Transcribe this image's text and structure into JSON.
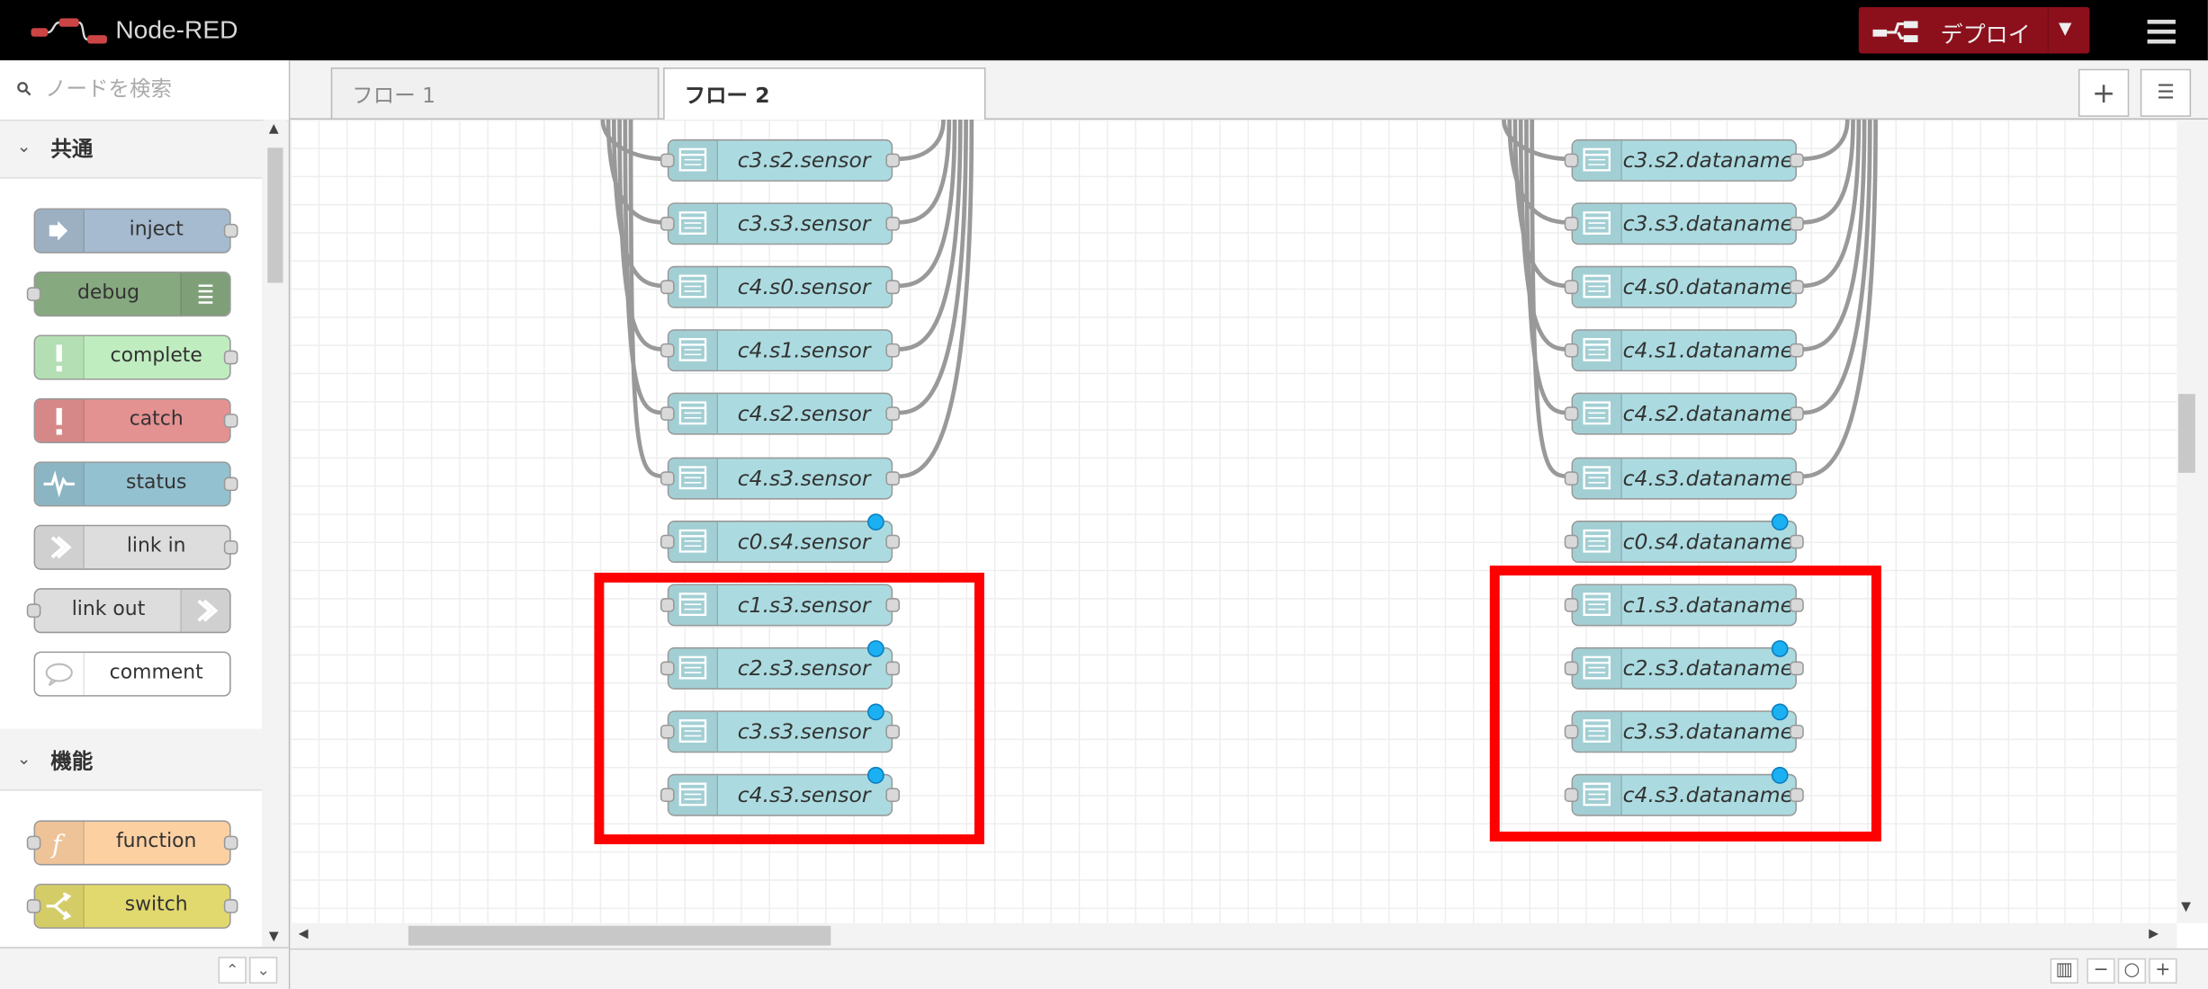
{
  "header": {
    "app_title": "Node-RED",
    "deploy_label": "デプロイ",
    "deploy_color": "#8c101c"
  },
  "palette": {
    "search_placeholder": "ノードを検索",
    "categories": [
      {
        "label": "共通",
        "nodes": [
          {
            "label": "inject",
            "color": "#a6bbcf"
          },
          {
            "label": "debug",
            "color": "#87a980"
          },
          {
            "label": "complete",
            "color": "#c0edc0"
          },
          {
            "label": "catch",
            "color": "#e49191"
          },
          {
            "label": "status",
            "color": "#94c1d0"
          },
          {
            "label": "link in",
            "color": "#dddddd"
          },
          {
            "label": "link out",
            "color": "#dddddd"
          },
          {
            "label": "comment",
            "color": "#ffffff"
          }
        ]
      },
      {
        "label": "機能",
        "nodes": [
          {
            "label": "function",
            "color": "#fdd0a2"
          },
          {
            "label": "switch",
            "color": "#e2d96e"
          }
        ]
      }
    ]
  },
  "tabs": [
    {
      "label": "フロー 1",
      "active": false
    },
    {
      "label": "フロー 2",
      "active": true
    }
  ],
  "flow": {
    "node_color": "#abdbe0",
    "highlight_color": "#ff0000",
    "left_column": [
      "c3.s2.sensor",
      "c3.s3.sensor",
      "c4.s0.sensor",
      "c4.s1.sensor",
      "c4.s2.sensor",
      "c4.s3.sensor",
      "c0.s4.sensor",
      "c1.s3.sensor",
      "c2.s3.sensor",
      "c3.s3.sensor",
      "c4.s3.sensor"
    ],
    "right_column": [
      "c3.s2.dataname",
      "c3.s3.dataname",
      "c4.s0.dataname",
      "c4.s1.dataname",
      "c4.s2.dataname",
      "c4.s3.dataname",
      "c0.s4.dataname",
      "c1.s3.dataname",
      "c2.s3.dataname",
      "c3.s3.dataname",
      "c4.s3.dataname"
    ]
  },
  "icons": {
    "logo": "node-red-logo-icon",
    "deploy": "deploy-icon",
    "menu": "hamburger-menu-icon",
    "search": "search-icon",
    "add_tab": "plus-icon",
    "tab_list": "list-icon",
    "zoom_out": "minus-icon",
    "zoom_reset": "circle-icon",
    "zoom_in": "plus-icon",
    "navigator": "map-icon"
  }
}
